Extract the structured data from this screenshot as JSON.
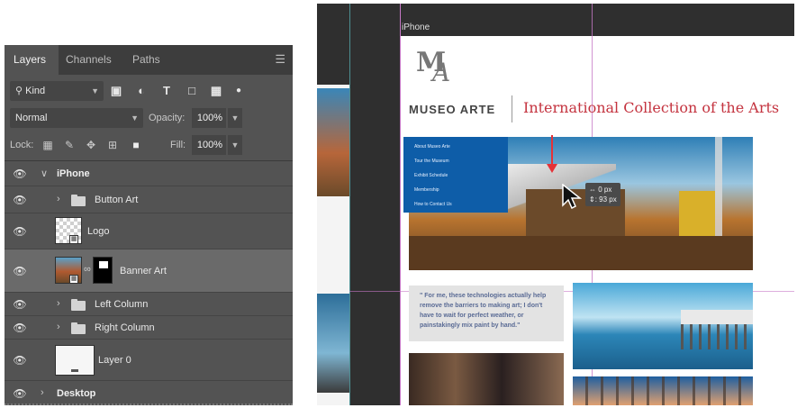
{
  "layers_panel": {
    "tabs": [
      "Layers",
      "Channels",
      "Paths"
    ],
    "filter": {
      "kind_label": "Kind",
      "icons": [
        "image-filter-icon",
        "adjustment-filter-icon",
        "type-filter-icon",
        "shape-filter-icon",
        "smart-object-filter-icon",
        "filter-toggle-icon"
      ]
    },
    "blend_mode": "Normal",
    "opacity_label": "Opacity:",
    "opacity_value": "100%",
    "lock_label": "Lock:",
    "fill_label": "Fill:",
    "fill_value": "100%",
    "layers": [
      {
        "name": "iPhone",
        "type": "artboard",
        "expanded": true
      },
      {
        "name": "Button Art",
        "type": "group"
      },
      {
        "name": "Logo",
        "type": "smart-object"
      },
      {
        "name": "Banner Art",
        "type": "smart-object-masked",
        "selected": true
      },
      {
        "name": "Left Column",
        "type": "group"
      },
      {
        "name": "Right Column",
        "type": "group"
      },
      {
        "name": "Layer 0",
        "type": "layer"
      },
      {
        "name": "Desktop",
        "type": "artboard",
        "expanded": false
      }
    ]
  },
  "document": {
    "artboard_label": "iPhone",
    "logo_name": "MUSEO ARTE",
    "headline": "International Collection of the Arts",
    "nav_items": [
      "About Museo Arte",
      "Tour the Museum",
      "Exhibit Schedule",
      "Membership",
      "How to Contact Us"
    ],
    "tooltip": {
      "line1": "0 px",
      "line2": ": 93 px"
    },
    "quote": "\" For me, these technologies actually help remove the barriers to making art; I don't have to wait for perfect weather, or painstakingly mix paint by hand.\""
  },
  "colors": {
    "panel_bg": "#535353",
    "headline_red": "#c4333f",
    "nav_blue": "#0e5da8",
    "guide_magenta": "#c678c6",
    "arrow_red": "#e53238"
  }
}
